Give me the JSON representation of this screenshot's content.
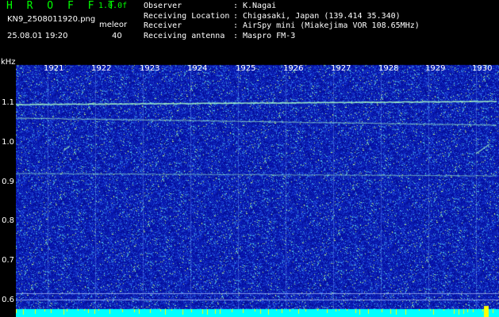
{
  "header": {
    "app_name": "H R O F F T",
    "version": "1.0.0f",
    "filename": "KN9_2508011920.png",
    "datetime": "25.08.01 19:20",
    "mode_label": "meleor",
    "mode_value": "40"
  },
  "info": [
    {
      "key": "Observer",
      "value": "K.Nagai"
    },
    {
      "key": "Receiving Location",
      "value": "Chigasaki, Japan (139.414 35.340)"
    },
    {
      "key": "Receiver",
      "value": "AirSpy mini (Miakejima VOR 108.65MHz)"
    },
    {
      "key": "Receiving antenna",
      "value": "Maspro FM-3"
    }
  ],
  "spectrogram": {
    "freq_unit": "kHz",
    "freq_labels": [
      "1.1",
      "1.0",
      "0.9",
      "0.8",
      "0.7",
      "0.6"
    ],
    "time_labels": [
      "1921",
      "1922",
      "1923",
      "1924",
      "1925",
      "1926",
      "1927",
      "1928",
      "1929",
      "1930"
    ],
    "colors": {
      "background": "#000000",
      "noise_base": "#0a1ea8",
      "signal": "#a8ffc8",
      "baseline": "#00ffff",
      "marker": "#ffff00"
    }
  }
}
